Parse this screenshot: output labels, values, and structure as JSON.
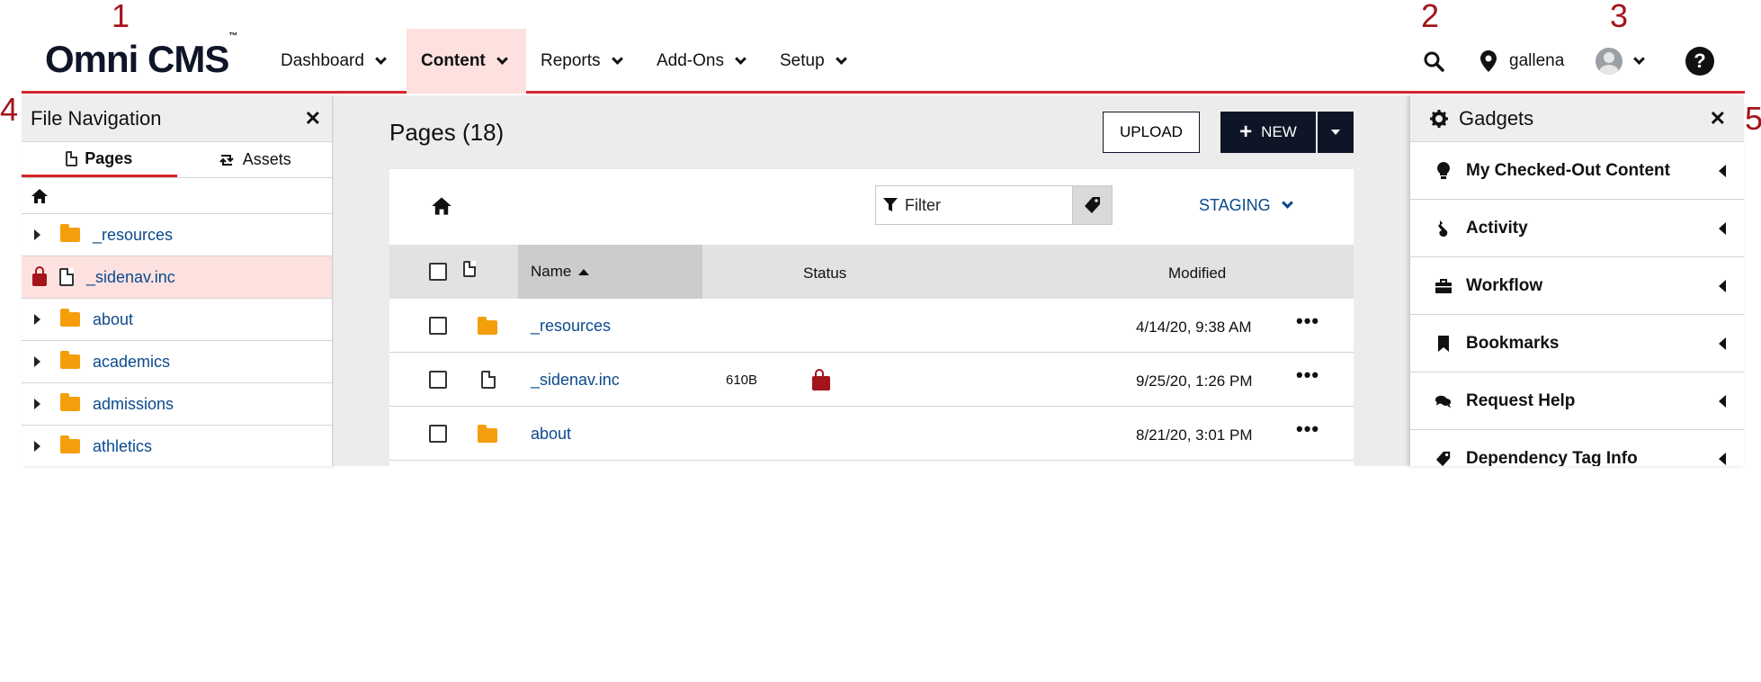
{
  "callouts": [
    "1",
    "2",
    "3",
    "4",
    "5"
  ],
  "header": {
    "logo": "Omni CMS",
    "logo_tm": "™",
    "nav": [
      {
        "label": "Dashboard"
      },
      {
        "label": "Content"
      },
      {
        "label": "Reports"
      },
      {
        "label": "Add-Ons"
      },
      {
        "label": "Setup"
      }
    ],
    "site": "gallena",
    "help": "?"
  },
  "file_nav": {
    "title": "File Navigation",
    "tabs": [
      {
        "label": "Pages"
      },
      {
        "label": "Assets"
      }
    ],
    "items": [
      {
        "label": "_resources",
        "type": "folder"
      },
      {
        "label": "_sidenav.inc",
        "type": "file",
        "locked": true
      },
      {
        "label": "about",
        "type": "folder"
      },
      {
        "label": "academics",
        "type": "folder"
      },
      {
        "label": "admissions",
        "type": "folder"
      },
      {
        "label": "athletics",
        "type": "folder"
      }
    ]
  },
  "main": {
    "title": "Pages (18)",
    "upload_label": "UPLOAD",
    "new_label": "NEW",
    "filter_placeholder": "Filter",
    "staging_label": "STAGING",
    "columns": {
      "name": "Name",
      "status": "Status",
      "modified": "Modified"
    },
    "rows": [
      {
        "name": "_resources",
        "type": "folder",
        "size": "",
        "locked": false,
        "modified": "4/14/20, 9:38 AM"
      },
      {
        "name": "_sidenav.inc",
        "type": "file",
        "size": "610B",
        "locked": true,
        "modified": "9/25/20, 1:26 PM"
      },
      {
        "name": "about",
        "type": "folder",
        "size": "",
        "locked": false,
        "modified": "8/21/20, 3:01 PM"
      }
    ],
    "more": "•••"
  },
  "gadgets": {
    "title": "Gadgets",
    "items": [
      {
        "label": "My Checked-Out Content",
        "icon": "lightbulb-icon"
      },
      {
        "label": "Activity",
        "icon": "activity-icon"
      },
      {
        "label": "Workflow",
        "icon": "briefcase-icon"
      },
      {
        "label": "Bookmarks",
        "icon": "bookmark-icon"
      },
      {
        "label": "Request Help",
        "icon": "comments-icon"
      },
      {
        "label": "Dependency Tag Info",
        "icon": "tag-icon"
      }
    ]
  },
  "colors": {
    "accent": "#d7262d",
    "navy": "#0e1527",
    "link": "#0b4a8c",
    "folder": "#f59e0b",
    "lock": "#a3141b"
  }
}
